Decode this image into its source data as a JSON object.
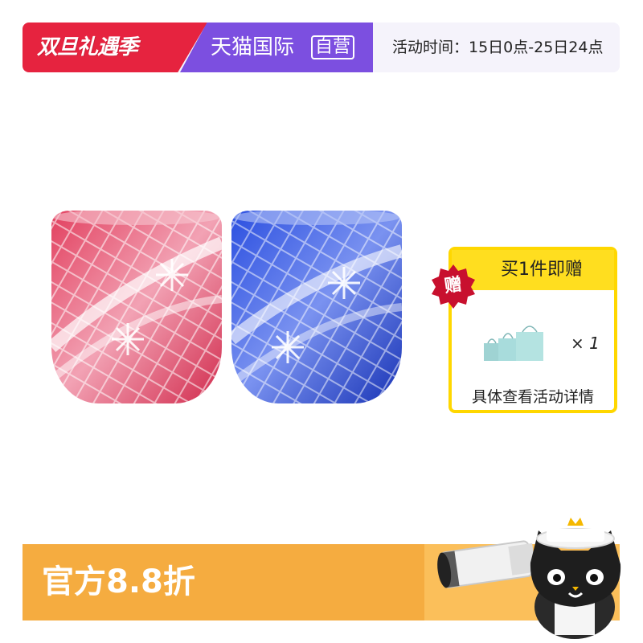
{
  "banner": {
    "event_name": "双旦礼遇季",
    "store_name": "天猫国际",
    "self_operated_badge": "自营",
    "event_time": "活动时间：15日0点-25日24点"
  },
  "gift": {
    "title": "买1件即赠",
    "seal": "赠",
    "count": "× 1",
    "note": "具体查看活动详情"
  },
  "discount": {
    "label": "官方8.8折"
  },
  "colors": {
    "event_red": "#e6233f",
    "tmall_purple": "#7c4fe0",
    "gift_yellow": "#ffde1f",
    "discount_orange": "#f5ac40",
    "glass_red": "#d8334f",
    "glass_blue": "#1f3cc9"
  }
}
